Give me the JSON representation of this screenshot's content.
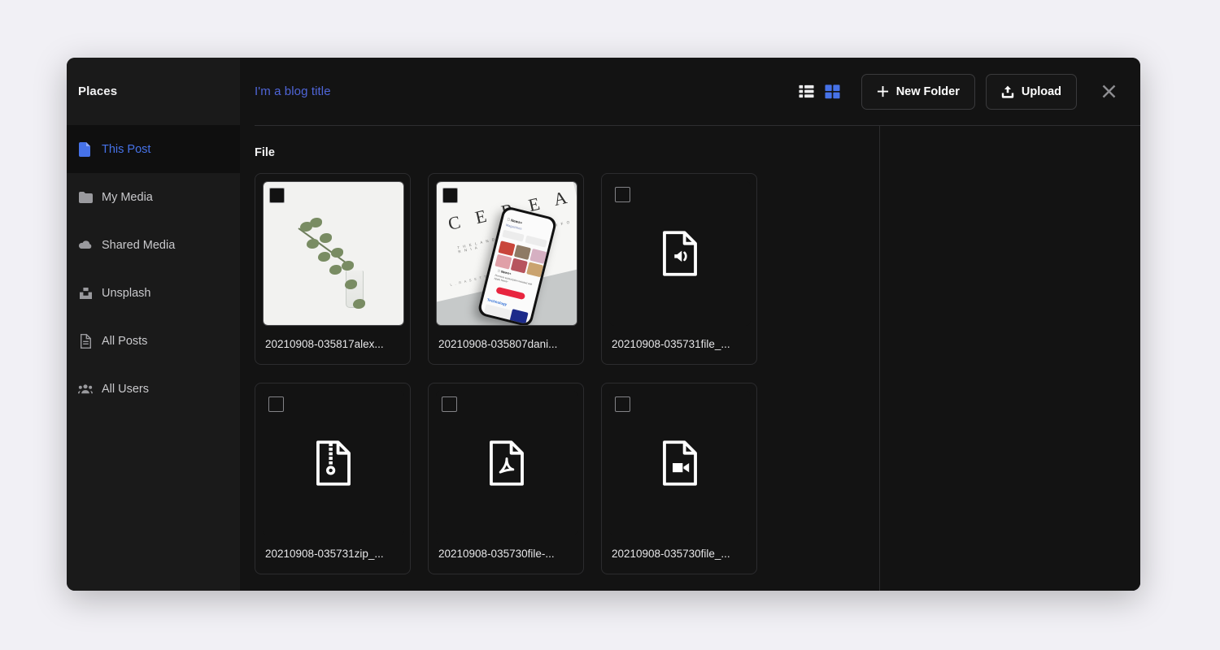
{
  "theme": {
    "page_background": "#f1f0f5",
    "modal_background": "#141414",
    "sidebar_background": "#1a1a1a",
    "accent_blue": "#4672e8",
    "title_link_blue": "#4f65d8",
    "text_primary": "#f1f1f2",
    "text_secondary": "#c9c9cc",
    "border": "#2c2c2e"
  },
  "sidebar": {
    "title": "Places",
    "items": [
      {
        "label": "This Post",
        "icon": "document-icon",
        "active": true
      },
      {
        "label": "My Media",
        "icon": "folder-icon",
        "active": false
      },
      {
        "label": "Shared Media",
        "icon": "cloud-icon",
        "active": false
      },
      {
        "label": "Unsplash",
        "icon": "unsplash-icon",
        "active": false
      },
      {
        "label": "All Posts",
        "icon": "file-lines-icon",
        "active": false
      },
      {
        "label": "All Users",
        "icon": "users-icon",
        "active": false
      }
    ]
  },
  "topbar": {
    "blog_title": "I'm a blog title",
    "view_list_label": "List view",
    "view_grid_label": "Grid view",
    "active_view": "grid",
    "new_folder_label": "New Folder",
    "upload_label": "Upload",
    "close_label": "Close"
  },
  "main": {
    "section_label": "File",
    "files": [
      {
        "name": "20210908-035817alex...",
        "kind": "image",
        "thumb": "plant-photo",
        "selected": false
      },
      {
        "name": "20210908-035807dani...",
        "kind": "image",
        "thumb": "cereal-photo",
        "selected": false
      },
      {
        "name": "20210908-035731file_...",
        "kind": "audio",
        "thumb": "audio-file-icon",
        "selected": false
      },
      {
        "name": "20210908-035731zip_...",
        "kind": "zip",
        "thumb": "zip-file-icon",
        "selected": false
      },
      {
        "name": "20210908-035730file-...",
        "kind": "pdf",
        "thumb": "pdf-file-icon",
        "selected": false
      },
      {
        "name": "20210908-035730file_...",
        "kind": "video",
        "thumb": "video-file-icon",
        "selected": false
      }
    ]
  }
}
